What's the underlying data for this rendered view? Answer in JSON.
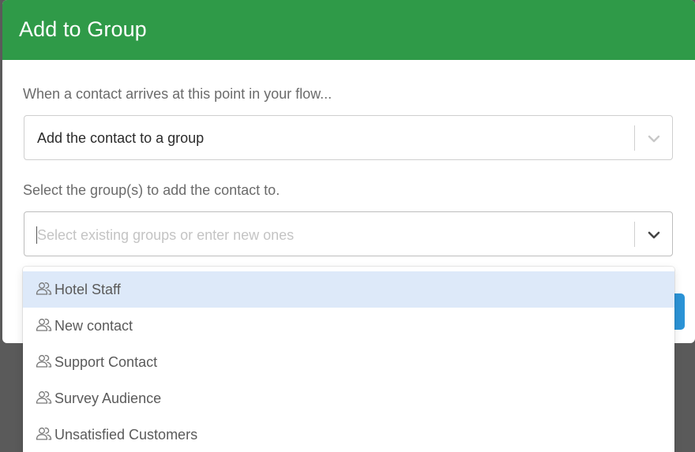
{
  "dialog": {
    "title": "Add to Group",
    "prompt_action": "When a contact arrives at this point in your flow...",
    "action_select": {
      "value": "Add the contact to a group",
      "icon": "chevron-down-icon"
    },
    "prompt_groups": "Select the group(s) to add the contact to.",
    "group_select": {
      "placeholder": "Select existing groups or enter new ones",
      "icon": "chevron-down-icon"
    }
  },
  "dropdown": {
    "item_icon": "group-icon",
    "items": [
      {
        "label": "Hotel Staff",
        "highlighted": true
      },
      {
        "label": "New contact",
        "highlighted": false
      },
      {
        "label": "Support Contact",
        "highlighted": false
      },
      {
        "label": "Survey Audience",
        "highlighted": false
      },
      {
        "label": "Unsatisfied Customers",
        "highlighted": false
      }
    ]
  },
  "colors": {
    "header": "#2f9a48",
    "highlight": "#dde9f9",
    "primary_button": "#2b93d6"
  }
}
